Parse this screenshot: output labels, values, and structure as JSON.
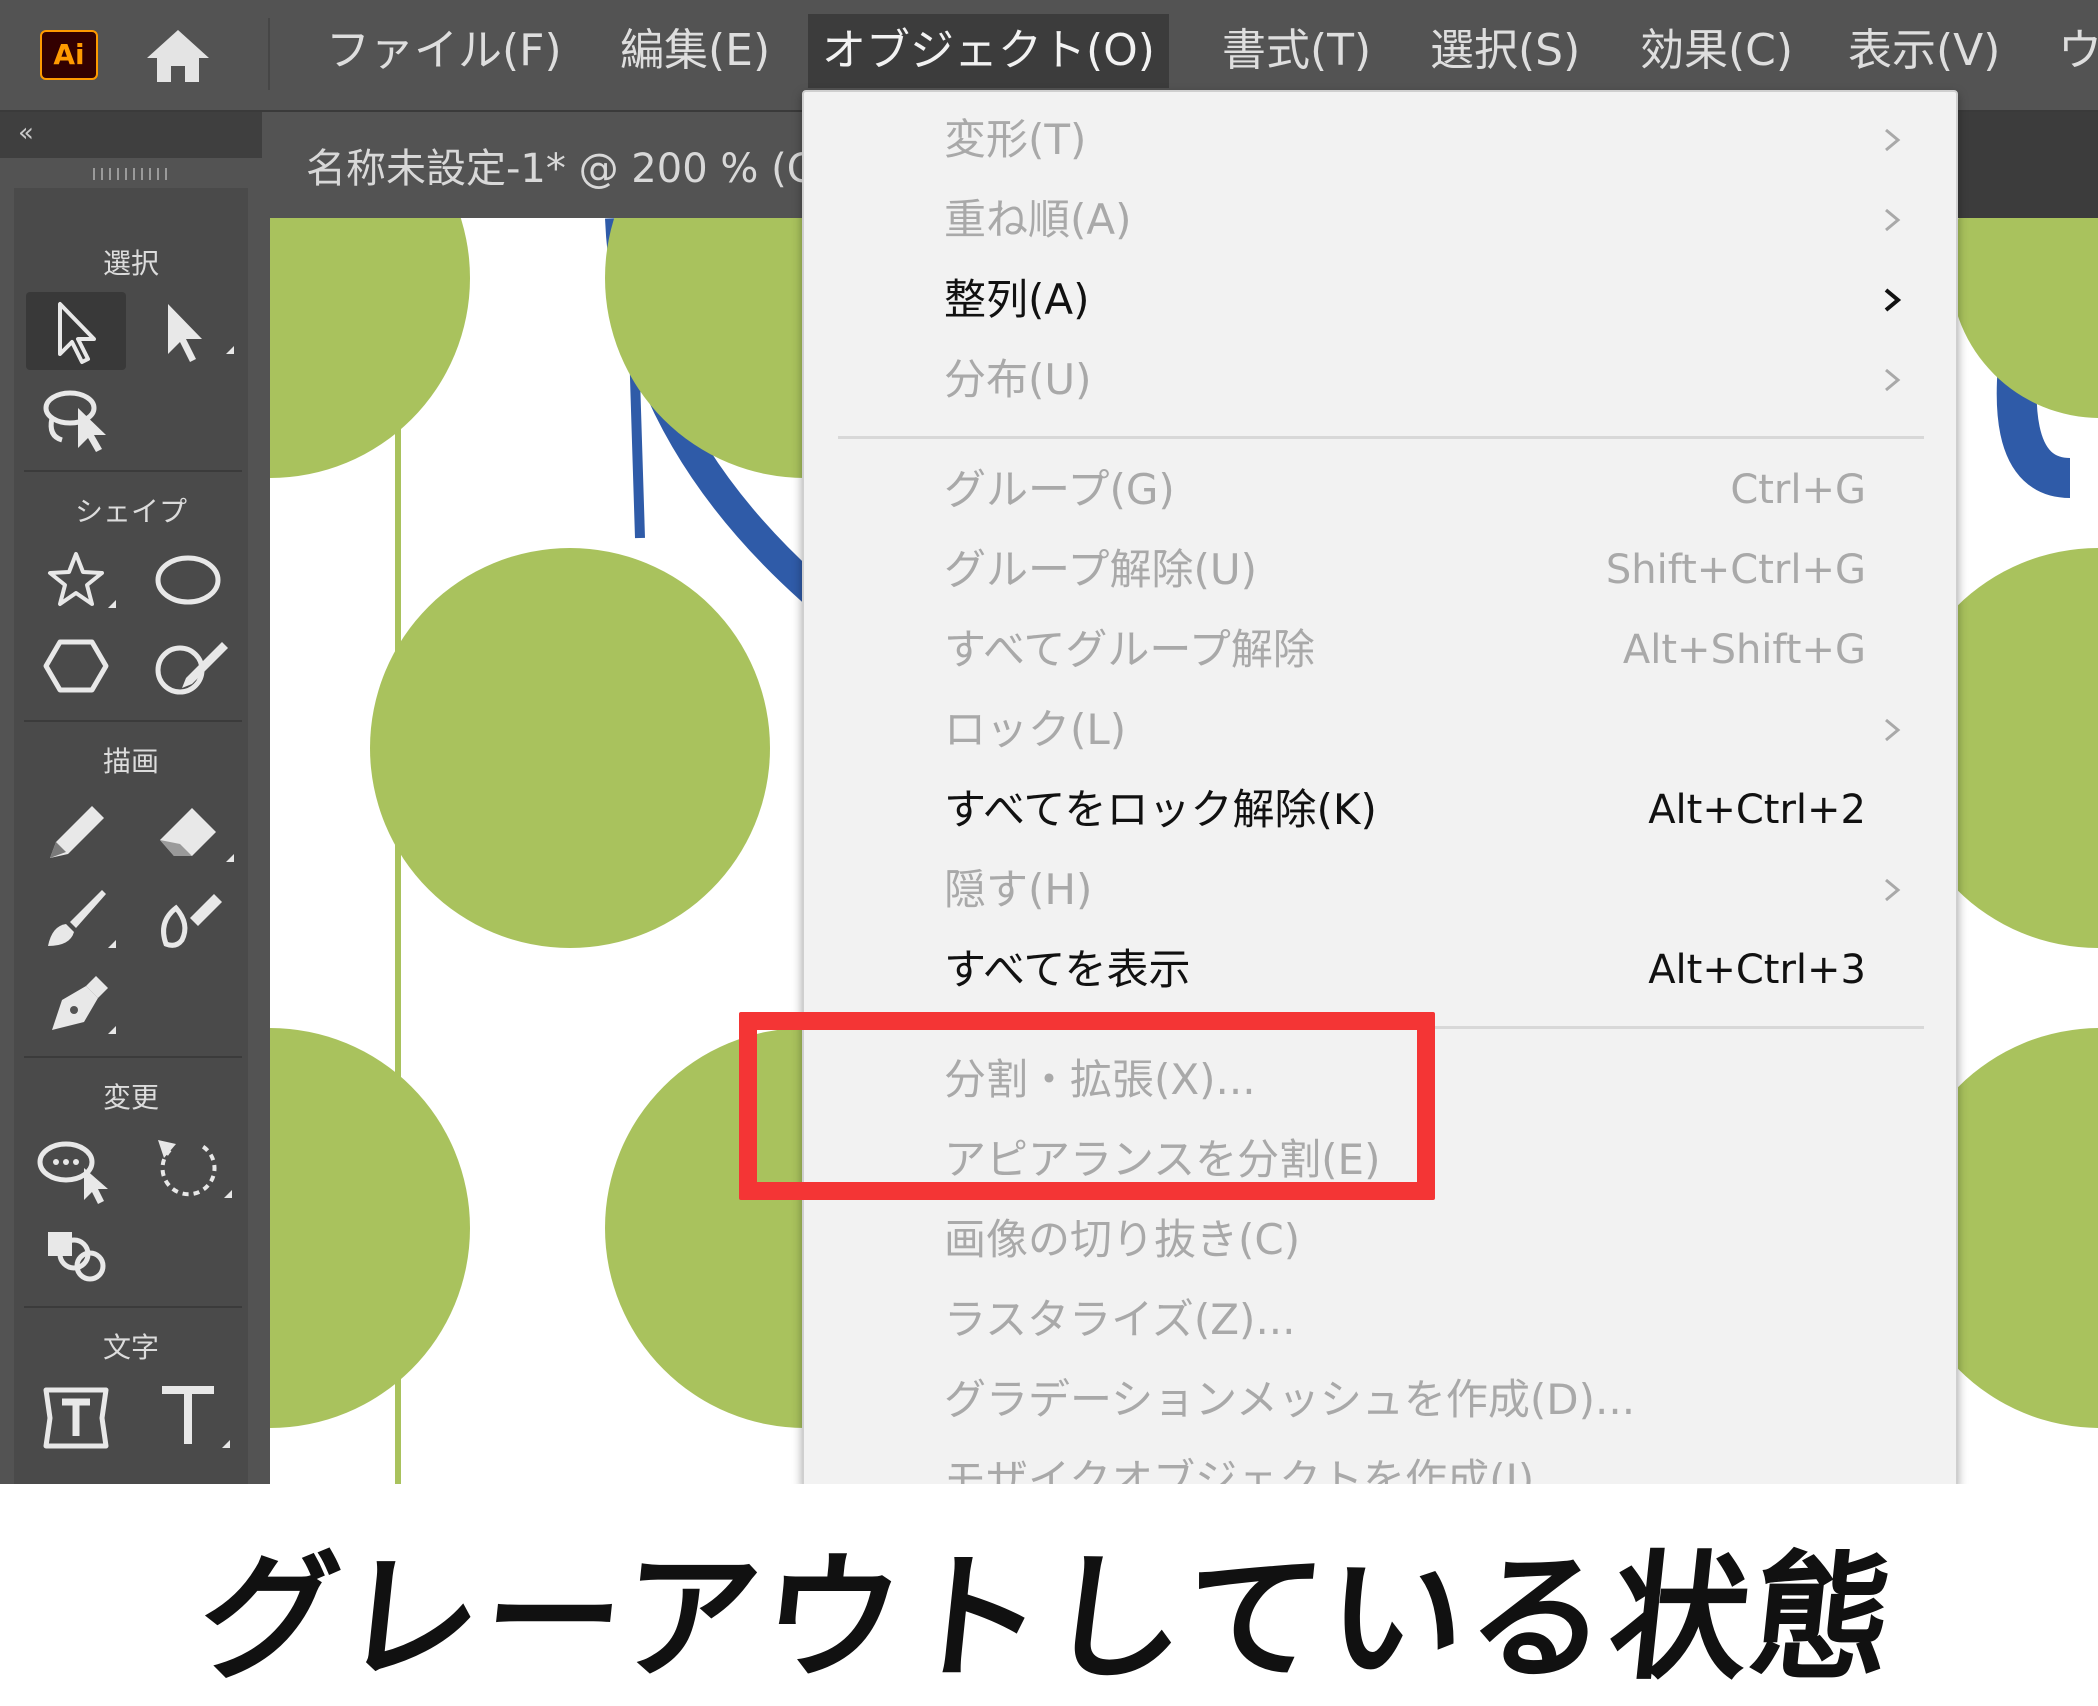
{
  "app": {
    "logo_text": "Ai"
  },
  "menubar": {
    "items": [
      {
        "label": "ファイル(F)"
      },
      {
        "label": "編集(E)"
      },
      {
        "label": "オブジェクト(O)",
        "active": true
      },
      {
        "label": "書式(T)"
      },
      {
        "label": "選択(S)"
      },
      {
        "label": "効果(C)"
      },
      {
        "label": "表示(V)"
      },
      {
        "label": "ウ"
      }
    ]
  },
  "document_tab": {
    "label": "名称未設定-1* @ 200 % (C"
  },
  "toolbox": {
    "collapse_glyph": "«",
    "groups": [
      {
        "label": "選択",
        "tools": [
          "selection-tool-icon",
          "direct-selection-tool-icon",
          "lasso-tool-icon"
        ]
      },
      {
        "label": "シェイプ",
        "tools": [
          "star-tool-icon",
          "ellipse-tool-icon",
          "polygon-tool-icon",
          "shaper-tool-icon"
        ]
      },
      {
        "label": "描画",
        "tools": [
          "pencil-tool-icon",
          "eraser-tool-icon",
          "paintbrush-tool-icon",
          "blob-brush-tool-icon",
          "pen-tool-icon"
        ]
      },
      {
        "label": "変更",
        "tools": [
          "warp-tool-icon",
          "rotate-tool-icon",
          "shape-builder-tool-icon"
        ]
      },
      {
        "label": "文字",
        "tools": [
          "touch-type-tool-icon",
          "type-tool-icon"
        ]
      }
    ]
  },
  "object_menu": {
    "items": [
      {
        "label": "変形(T)",
        "shortcut": "",
        "submenu": true,
        "enabled": false
      },
      {
        "label": "重ね順(A)",
        "shortcut": "",
        "submenu": true,
        "enabled": false
      },
      {
        "label": "整列(A)",
        "shortcut": "",
        "submenu": true,
        "enabled": true
      },
      {
        "label": "分布(U)",
        "shortcut": "",
        "submenu": true,
        "enabled": false
      },
      {
        "label": "グループ(G)",
        "shortcut": "Ctrl+G",
        "submenu": false,
        "enabled": false
      },
      {
        "label": "グループ解除(U)",
        "shortcut": "Shift+Ctrl+G",
        "submenu": false,
        "enabled": false
      },
      {
        "label": "すべてグループ解除",
        "shortcut": "Alt+Shift+G",
        "submenu": false,
        "enabled": false
      },
      {
        "label": "ロック(L)",
        "shortcut": "",
        "submenu": true,
        "enabled": false
      },
      {
        "label": "すべてをロック解除(K)",
        "shortcut": "Alt+Ctrl+2",
        "submenu": false,
        "enabled": true
      },
      {
        "label": "隠す(H)",
        "shortcut": "",
        "submenu": true,
        "enabled": false
      },
      {
        "label": "すべてを表示",
        "shortcut": "Alt+Ctrl+3",
        "submenu": false,
        "enabled": true
      },
      {
        "label": "分割・拡張(X)...",
        "shortcut": "",
        "submenu": false,
        "enabled": false
      },
      {
        "label": "アピアランスを分割(E)",
        "shortcut": "",
        "submenu": false,
        "enabled": false
      },
      {
        "label": "画像の切り抜き(C)",
        "shortcut": "",
        "submenu": false,
        "enabled": false
      },
      {
        "label": "ラスタライズ(Z)...",
        "shortcut": "",
        "submenu": false,
        "enabled": false
      },
      {
        "label": "グラデーションメッシュを作成(D)...",
        "shortcut": "",
        "submenu": false,
        "enabled": false
      },
      {
        "label": "モザイクオブジェクトを作成(J)...",
        "shortcut": "",
        "submenu": false,
        "enabled": false
      }
    ]
  },
  "highlight": {
    "color": "#f43535"
  },
  "artwork": {
    "dot_color": "#a9c25d",
    "stroke_color": "#2f5ba8"
  },
  "caption": {
    "text": "グレーアウトしている状態"
  }
}
